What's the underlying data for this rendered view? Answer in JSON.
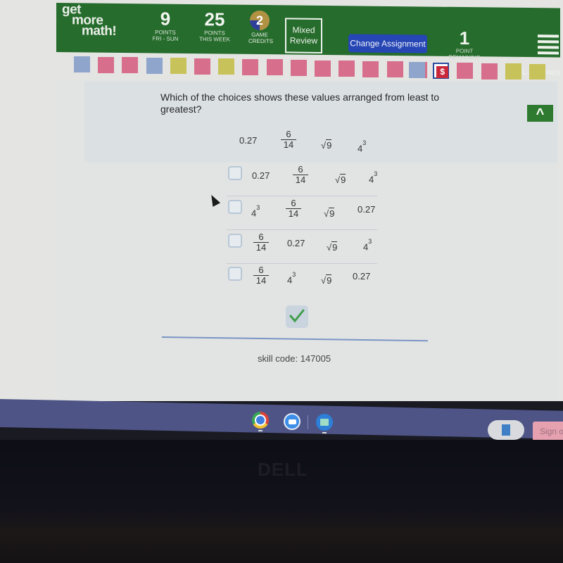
{
  "header": {
    "logo": {
      "line1": "get",
      "line2": "more",
      "line3": "math!"
    },
    "stats": [
      {
        "value": "9",
        "label_line1": "POINTS",
        "label_line2": "FRI - SUN"
      },
      {
        "value": "25",
        "label_line1": "POINTS",
        "label_line2": "THIS WEEK"
      }
    ],
    "game_credits": {
      "value": "2",
      "label_line1": "GAME",
      "label_line2": "CREDITS"
    },
    "mixed_review": {
      "line1": "Mixed",
      "line2": "Review"
    },
    "change_assignment_label": "Change Assignment",
    "points_remaining": {
      "value": "1",
      "label_line1": "POINT",
      "label_line2": "REMAINING"
    },
    "user_name": "L. Holmes"
  },
  "progress_squares": [
    {
      "color": "#8fa5cc"
    },
    {
      "color": "#d66e8c"
    },
    {
      "color": "#d66e8c"
    },
    {
      "color": "#8fa5cc"
    },
    {
      "color": "#c7c25a"
    },
    {
      "color": "#d66e8c"
    },
    {
      "color": "#c7c25a"
    },
    {
      "color": "#d66e8c"
    },
    {
      "color": "#d66e8c"
    },
    {
      "color": "#d66e8c"
    },
    {
      "color": "#d66e8c"
    },
    {
      "color": "#d66e8c"
    },
    {
      "color": "#d66e8c"
    },
    {
      "color": "#d66e8c"
    },
    {
      "color": "#d66e8c"
    },
    {
      "color": "#8fa5cc"
    },
    {
      "color": "#c8283a",
      "label": "$",
      "current": true
    },
    {
      "color": "#d66e8c"
    },
    {
      "color": "#d66e8c"
    },
    {
      "color": "#c7c25a"
    },
    {
      "color": "#c7c25a"
    }
  ],
  "question": {
    "text": "Which of the choices shows these values arranged from least to greatest?",
    "values": {
      "decimal": "0.27",
      "fraction": {
        "numerator": "6",
        "denominator": "14"
      },
      "sqrt": {
        "symbol": "√",
        "radicand": "9"
      },
      "power": {
        "base": "4",
        "exponent": "3"
      }
    },
    "choices": [
      {
        "order": [
          "0.27",
          "6/14",
          "√9",
          "4^3"
        ],
        "checked": false
      },
      {
        "order": [
          "4^3",
          "6/14",
          "√9",
          "0.27"
        ],
        "checked": false
      },
      {
        "order": [
          "6/14",
          "0.27",
          "√9",
          "4^3"
        ],
        "checked": false
      },
      {
        "order": [
          "6/14",
          "4^3",
          "√9",
          "0.27"
        ],
        "checked": false
      }
    ]
  },
  "submit_icon": "checkmark-icon",
  "skill_code": "skill code: 147005",
  "taskbar": {
    "apps": [
      "chrome-icon",
      "zoom-icon",
      "files-icon"
    ],
    "sign_out_label": "Sign out"
  },
  "laptop_brand": "DELL",
  "colors": {
    "header_green": "#266c2c",
    "change_button_blue": "#2546b4",
    "check_green": "#3f9e4b"
  }
}
